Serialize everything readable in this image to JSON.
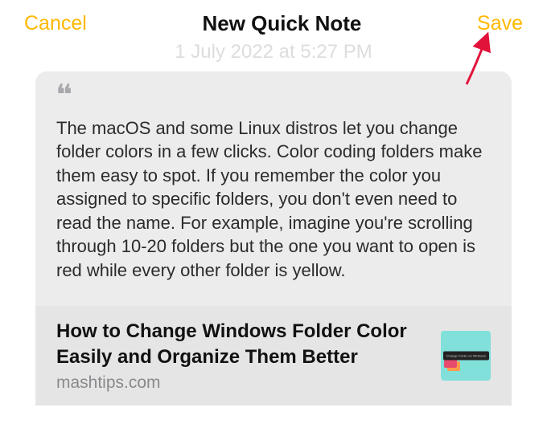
{
  "header": {
    "cancel_label": "Cancel",
    "title": "New Quick Note",
    "save_label": "Save"
  },
  "timestamp": "1 July 2022 at 5:27 PM",
  "quote": {
    "text": "The macOS and some Linux distros let you change folder colors in a few clicks. Color coding folders make them easy to spot. If you remember the color you assigned to specific folders, you don't even need to read the name. For example, imagine you're scrolling through 10-20 folders but the one you want to open is red while every other folder is yellow."
  },
  "link": {
    "title": "How to Change Windows Folder Color Easily and Organize Them Better",
    "domain": "mashtips.com",
    "thumb_caption": "Change Folder on Windows"
  }
}
